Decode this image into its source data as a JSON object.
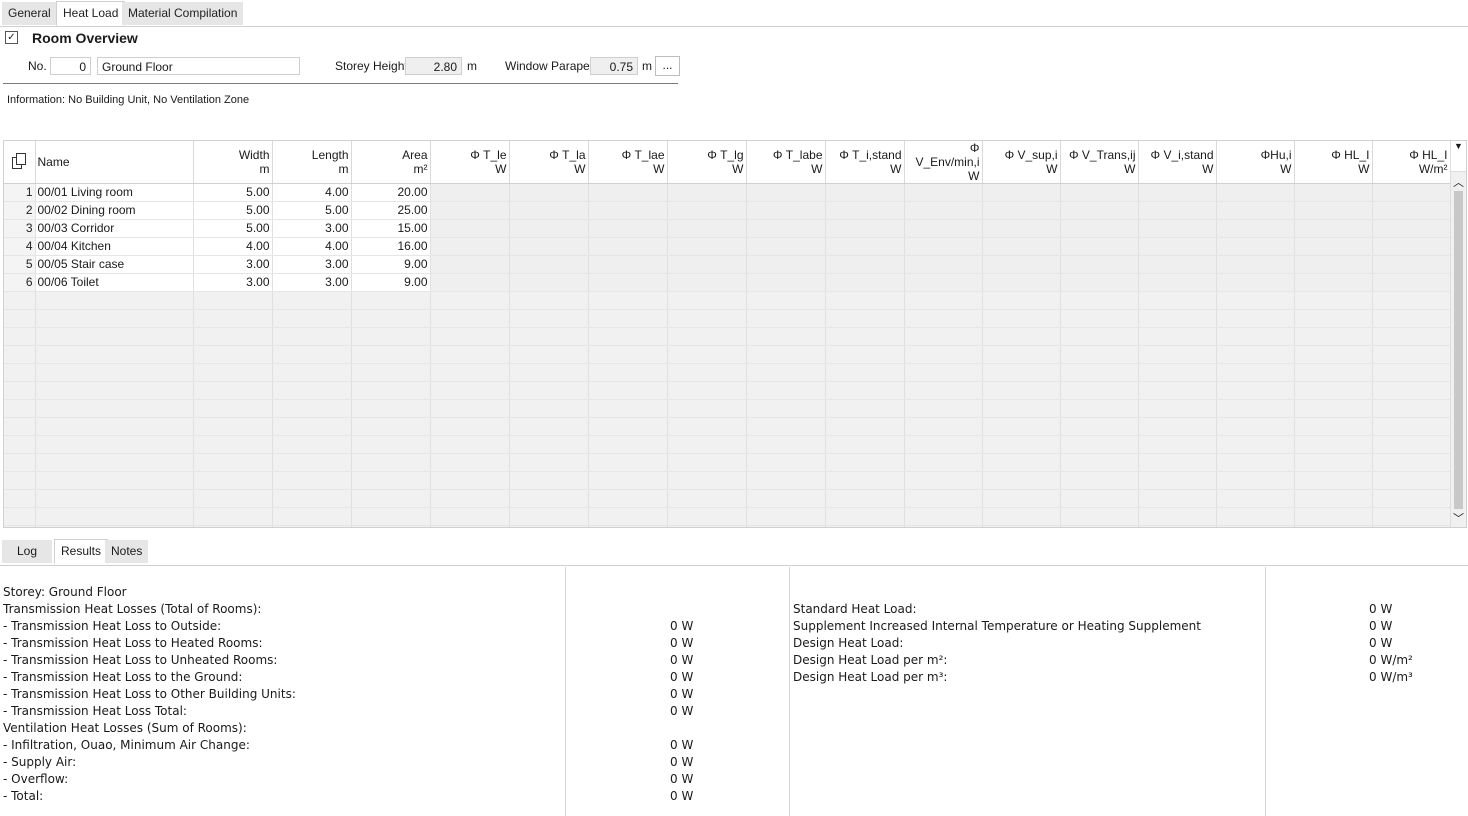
{
  "tabs": [
    "General",
    "Heat Load",
    "Material Compilation"
  ],
  "header": {
    "title": "Room Overview",
    "no_label": "No.",
    "no_value": "0",
    "floor_name": "Ground Floor",
    "storey_height_label": "Storey Height",
    "storey_height_value": "2.80",
    "storey_height_unit": "m",
    "window_parapet_label": "Window Parapet",
    "window_parapet_value": "0.75",
    "window_parapet_unit": "m",
    "more_button": "...",
    "info": "Information: No Building Unit, No Ventilation Zone"
  },
  "grid": {
    "columns": [
      {
        "name": "Name",
        "unit": ""
      },
      {
        "name": "Width",
        "unit": "m"
      },
      {
        "name": "Length",
        "unit": "m"
      },
      {
        "name": "Area",
        "unit": "m²"
      },
      {
        "name": "Φ T_le",
        "unit": "W"
      },
      {
        "name": "Φ T_la",
        "unit": "W"
      },
      {
        "name": "Φ T_lae",
        "unit": "W"
      },
      {
        "name": "Φ T_lg",
        "unit": "W"
      },
      {
        "name": "Φ T_labe",
        "unit": "W"
      },
      {
        "name": "Φ T_i,stand",
        "unit": "W"
      },
      {
        "name": "Φ V_Env/min,i",
        "unit": "W"
      },
      {
        "name": "Φ V_sup,i",
        "unit": "W"
      },
      {
        "name": "Φ V_Trans,ij",
        "unit": "W"
      },
      {
        "name": "Φ V_i,stand",
        "unit": "W"
      },
      {
        "name": "ΦHu,i",
        "unit": "W"
      },
      {
        "name": "Φ HL_I",
        "unit": "W"
      },
      {
        "name": "Φ HL_I",
        "unit": "W/m²"
      }
    ],
    "rows": [
      {
        "n": "1",
        "name": "00/01 Living room",
        "width": "5.00",
        "length": "4.00",
        "area": "20.00"
      },
      {
        "n": "2",
        "name": "00/02 Dining room",
        "width": "5.00",
        "length": "5.00",
        "area": "25.00"
      },
      {
        "n": "3",
        "name": "00/03 Corridor",
        "width": "5.00",
        "length": "3.00",
        "area": "15.00"
      },
      {
        "n": "4",
        "name": "00/04 Kitchen",
        "width": "4.00",
        "length": "4.00",
        "area": "16.00"
      },
      {
        "n": "5",
        "name": "00/05 Stair case",
        "width": "3.00",
        "length": "3.00",
        "area": "9.00"
      },
      {
        "n": "6",
        "name": "00/06 Toilet",
        "width": "3.00",
        "length": "3.00",
        "area": "9.00"
      }
    ]
  },
  "bottom_tabs": [
    "Log",
    "Results",
    "Notes"
  ],
  "results": {
    "left": [
      {
        "label": "Storey: Ground Floor",
        "value": ""
      },
      {
        "label": "Transmission Heat Losses (Total of Rooms):",
        "value": ""
      },
      {
        "label": "- Transmission Heat Loss to Outside:",
        "value": "0 W"
      },
      {
        "label": "- Transmission Heat Loss to Heated Rooms:",
        "value": "0 W"
      },
      {
        "label": "- Transmission Heat Loss to Unheated Rooms:",
        "value": "0 W"
      },
      {
        "label": "- Transmission Heat Loss to the Ground:",
        "value": "0 W"
      },
      {
        "label": "- Transmission Heat Loss to Other Building Units:",
        "value": "0 W"
      },
      {
        "label": "- Transmission Heat Loss Total:",
        "value": "0 W"
      },
      {
        "label": "Ventilation Heat Losses (Sum of Rooms):",
        "value": ""
      },
      {
        "label": "- Infiltration, Ouao, Minimum Air Change:",
        "value": "0 W"
      },
      {
        "label": "- Supply Air:",
        "value": "0 W"
      },
      {
        "label": "- Overflow:",
        "value": "0 W"
      },
      {
        "label": "- Total:",
        "value": "0 W"
      }
    ],
    "right": [
      {
        "label": "Standard Heat Load:",
        "value": "0 W"
      },
      {
        "label": "Supplement Increased Internal Temperature or Heating Supplement",
        "value": "0 W"
      },
      {
        "label": "Design Heat Load:",
        "value": "0 W"
      },
      {
        "label": "Design Heat Load per m²:",
        "value": "0 W/m²"
      },
      {
        "label": "Design Heat Load per m³:",
        "value": "0 W/m³"
      }
    ]
  }
}
